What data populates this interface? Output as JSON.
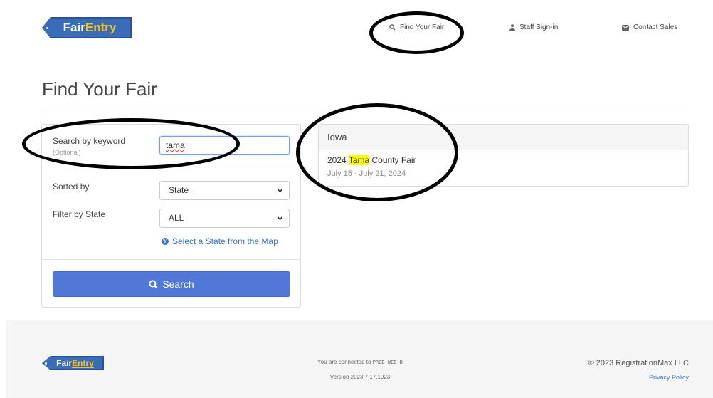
{
  "brand": {
    "fair": "Fair",
    "entry": "Entry"
  },
  "nav": {
    "find_fair": "Find Your Fair",
    "staff_signin": "Staff Sign-in",
    "contact_sales": "Contact Sales"
  },
  "page_title": "Find Your Fair",
  "search_form": {
    "keyword_label": "Search by keyword",
    "keyword_sublabel": "(Optional)",
    "keyword_value": "tama",
    "sorted_by_label": "Sorted by",
    "sorted_by_value": "State",
    "filter_state_label": "Filter by State",
    "filter_state_value": "ALL",
    "map_link": "Select a State from the Map",
    "search_button": "Search"
  },
  "results": {
    "group_heading": "Iowa",
    "items": [
      {
        "title_prefix": "2024 ",
        "title_highlight": "Tama",
        "title_suffix": " County Fair",
        "dates": "July 15 - July 21, 2024"
      }
    ]
  },
  "footer": {
    "connected_text": "You are connected to ",
    "server": "PROD-WEB-B",
    "version": "Version 2023.7.17.1923",
    "copyright": "© 2023 RegistrationMax LLC",
    "privacy": "Privacy Policy"
  },
  "colors": {
    "primary": "#5178d6",
    "logo_blue": "#3b6cb7",
    "logo_yellow": "#f5c518",
    "highlight": "#ffff00",
    "link": "#3a74c6"
  }
}
